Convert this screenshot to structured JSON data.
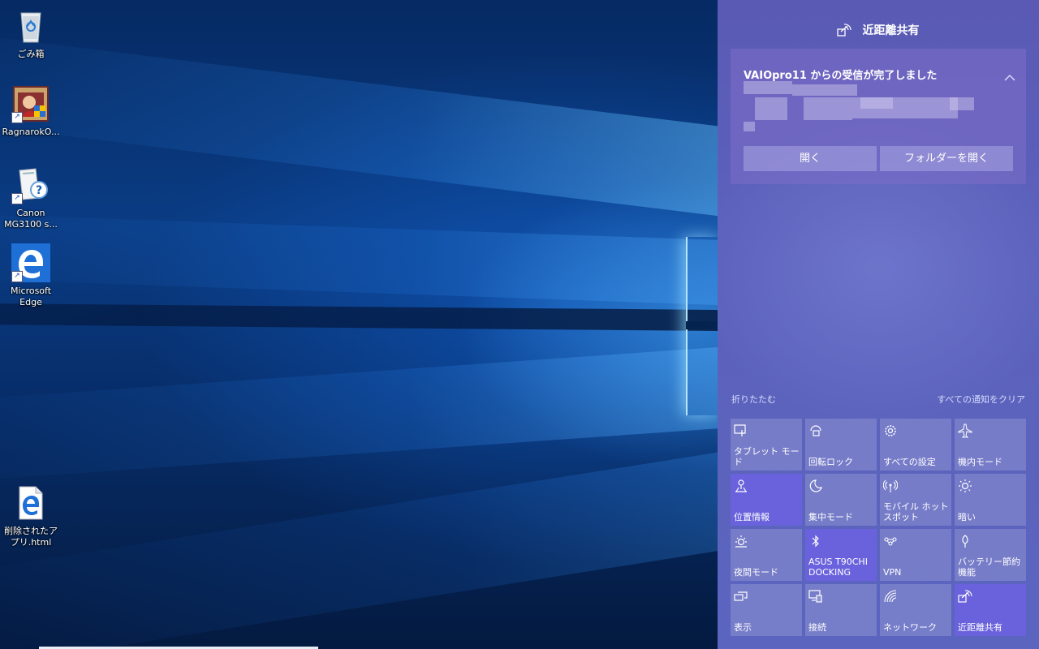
{
  "desktop": {
    "icons": [
      {
        "label": "ごみ箱",
        "icon": "recycle-bin-icon"
      },
      {
        "label": "RagnarokO...",
        "icon": "ragnarok-app-icon"
      },
      {
        "label": "Canon MG3100 s...",
        "icon": "canon-printer-help-icon"
      },
      {
        "label": "Microsoft Edge",
        "icon": "edge-icon"
      },
      {
        "label": "削除されたアプリ.html",
        "icon": "html-file-icon"
      }
    ]
  },
  "action_center": {
    "header": {
      "title": "近距離共有",
      "icon": "nearby-share-icon"
    },
    "notification": {
      "title": "VAIOpro11 からの受信が完了しました",
      "open_label": "開く",
      "open_folder_label": "フォルダーを開く"
    },
    "collapse_label": "折りたたむ",
    "clear_all_label": "すべての通知をクリア",
    "tiles": [
      {
        "label": "タブレット モード",
        "icon": "tablet-mode-icon",
        "active": false
      },
      {
        "label": "回転ロック",
        "icon": "rotation-lock-icon",
        "active": false
      },
      {
        "label": "すべての設定",
        "icon": "settings-gear-icon",
        "active": false
      },
      {
        "label": "機内モード",
        "icon": "airplane-icon",
        "active": false
      },
      {
        "label": "位置情報",
        "icon": "location-icon",
        "active": true
      },
      {
        "label": "集中モード",
        "icon": "moon-icon",
        "active": false
      },
      {
        "label": "モバイル ホットスポット",
        "icon": "hotspot-icon",
        "active": false
      },
      {
        "label": "暗い",
        "icon": "brightness-icon",
        "active": false
      },
      {
        "label": "夜間モード",
        "icon": "night-light-icon",
        "active": false
      },
      {
        "label": "ASUS T90CHI DOCKING",
        "icon": "bluetooth-icon",
        "active": true
      },
      {
        "label": "VPN",
        "icon": "vpn-icon",
        "active": false
      },
      {
        "label": "バッテリー節約機能",
        "icon": "battery-saver-icon",
        "active": false
      },
      {
        "label": "表示",
        "icon": "project-icon",
        "active": false
      },
      {
        "label": "接続",
        "icon": "connect-icon",
        "active": false
      },
      {
        "label": "ネットワーク",
        "icon": "network-icon",
        "active": false
      },
      {
        "label": "近距離共有",
        "icon": "nearby-share-icon",
        "active": true
      }
    ]
  },
  "colors": {
    "tile_active": "#6a62dc",
    "panel": "#5c62bc"
  }
}
